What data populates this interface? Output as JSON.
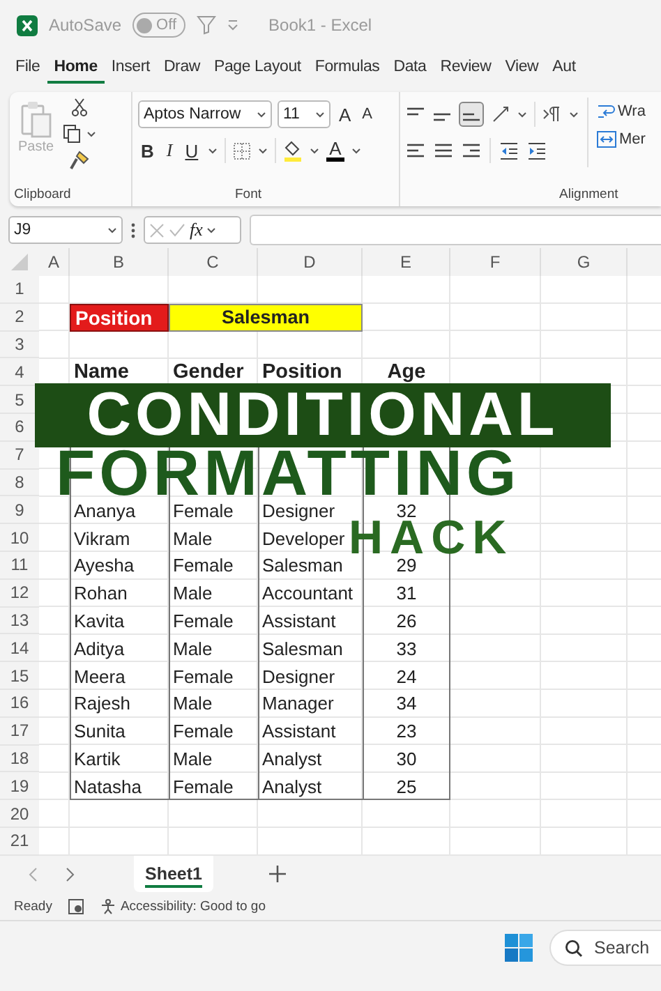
{
  "title_bar": {
    "autosave_label": "AutoSave",
    "autosave_toggle": {
      "label": "Off",
      "on": false
    },
    "title": "Book1 - Excel"
  },
  "menu_tabs": [
    {
      "label": "File",
      "selected": false
    },
    {
      "label": "Home",
      "selected": true
    },
    {
      "label": "Insert",
      "selected": false
    },
    {
      "label": "Draw",
      "selected": false
    },
    {
      "label": "Page Layout",
      "selected": false
    },
    {
      "label": "Formulas",
      "selected": false
    },
    {
      "label": "Data",
      "selected": false
    },
    {
      "label": "Review",
      "selected": false
    },
    {
      "label": "View",
      "selected": false
    },
    {
      "label": "Aut",
      "selected": false
    }
  ],
  "ribbon": {
    "clipboard": {
      "paste": "Paste",
      "group_label": "Clipboard"
    },
    "font": {
      "font_name": "Aptos Narrow",
      "font_size": "11",
      "grow": "A",
      "shrink": "A",
      "bold": "B",
      "italic": "I",
      "underline": "U",
      "font_color": "A",
      "group_label": "Font"
    },
    "alignment": {
      "wrap": "Wra",
      "merge": "Mer",
      "group_label": "Alignment"
    }
  },
  "formula_bar": {
    "name_box": "J9",
    "fx": "fx"
  },
  "columns": [
    "A",
    "B",
    "C",
    "D",
    "E",
    "F",
    "G"
  ],
  "row_numbers": [
    "1",
    "2",
    "3",
    "4",
    "5",
    "6",
    "7",
    "8",
    "9",
    "10",
    "11",
    "12",
    "13",
    "14",
    "15",
    "16",
    "17",
    "18",
    "19",
    "20",
    "21"
  ],
  "criteria": {
    "label": "Position",
    "value": "Salesman"
  },
  "table": {
    "headers": [
      "Name",
      "Gender",
      "Position",
      "Age"
    ],
    "rows": [
      {
        "name": "Ananya",
        "gender": "Female",
        "position": "Designer",
        "age": "32"
      },
      {
        "name": "Vikram",
        "gender": "Male",
        "position": "Developer"
      },
      {
        "name": "Ayesha",
        "gender": "Female",
        "position": "Salesman",
        "age": "29"
      },
      {
        "name": "Rohan",
        "gender": "Male",
        "position": "Accountant",
        "age": "31"
      },
      {
        "name": "Kavita",
        "gender": "Female",
        "position": "Assistant",
        "age": "26"
      },
      {
        "name": "Aditya",
        "gender": "Male",
        "position": "Salesman",
        "age": "33"
      },
      {
        "name": "Meera",
        "gender": "Female",
        "position": "Designer",
        "age": "24"
      },
      {
        "name": "Rajesh",
        "gender": "Male",
        "position": "Manager",
        "age": "34"
      },
      {
        "name": "Sunita",
        "gender": "Female",
        "position": "Assistant",
        "age": "23"
      },
      {
        "name": "Kartik",
        "gender": "Male",
        "position": "Analyst",
        "age": "30"
      },
      {
        "name": "Natasha",
        "gender": "Female",
        "position": "Analyst",
        "age": "25"
      }
    ]
  },
  "overlay": [
    {
      "text": "CONDITIONAL",
      "kind": "banner"
    },
    {
      "text": "FORMATTING",
      "kind": "plain"
    },
    {
      "text": "HACK",
      "kind": "plain"
    }
  ],
  "sheet_tabs": [
    {
      "label": "Sheet1",
      "selected": true
    }
  ],
  "status_bar": {
    "state": "Ready",
    "accessibility": "Accessibility: Good to go"
  },
  "taskbar": {
    "search": "Search"
  }
}
